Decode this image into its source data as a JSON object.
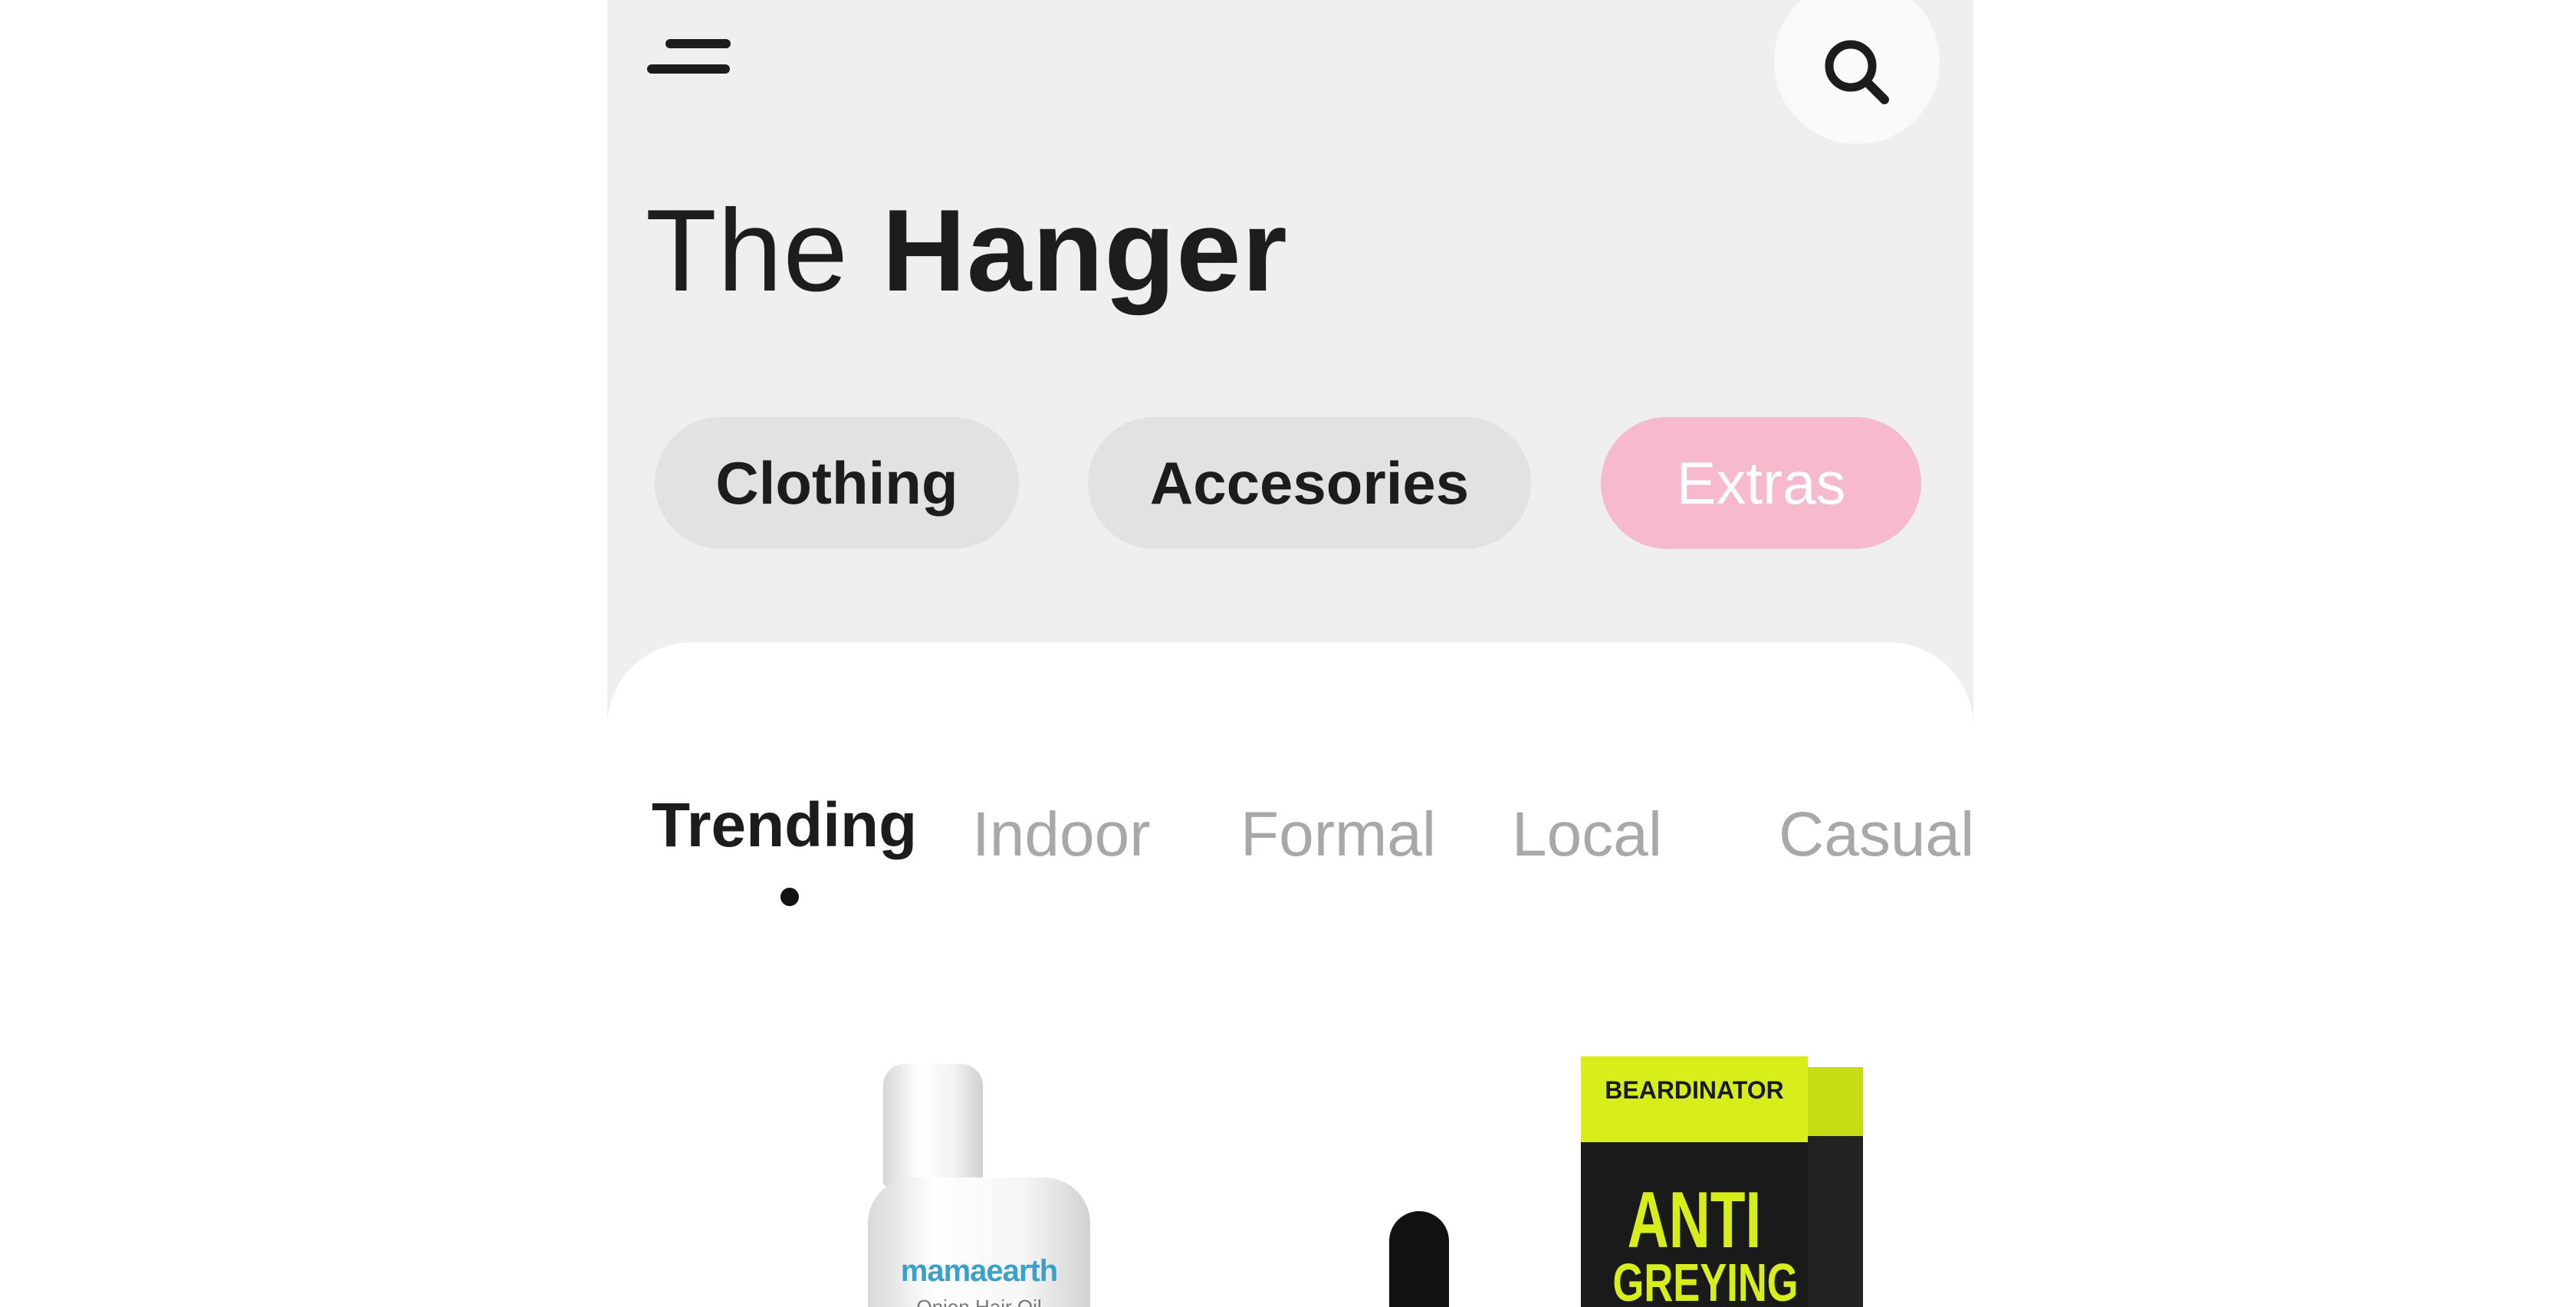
{
  "app": {
    "title_light": "The",
    "title_bold": "Hanger"
  },
  "header": {
    "menu_icon": "menu-icon",
    "search_icon": "search-icon"
  },
  "categories": [
    {
      "label": "Clothing",
      "selected": false
    },
    {
      "label": "Accesories",
      "selected": false
    },
    {
      "label": "Extras",
      "selected": true
    }
  ],
  "tabs": [
    {
      "label": "Trending",
      "active": true
    },
    {
      "label": "Indoor",
      "active": false
    },
    {
      "label": "Formal",
      "active": false
    },
    {
      "label": "Local",
      "active": false
    },
    {
      "label": "Casual",
      "active": false
    }
  ],
  "products": [
    {
      "brand": "mamaearth",
      "name": "Onion Hair Oil"
    },
    {
      "brand": "BEARDINATOR",
      "title_line1": "ANTI",
      "title_line2": "GREYING"
    }
  ],
  "colors": {
    "background": "#efefef",
    "sheet": "#ffffff",
    "accent_chip": "#f7b9cc",
    "text": "#1c1c1c",
    "muted": "#a8a8a8"
  }
}
